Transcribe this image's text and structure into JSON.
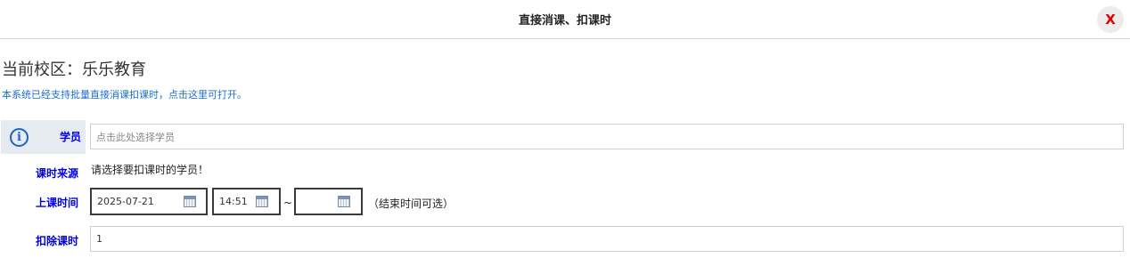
{
  "dialog": {
    "title": "直接消课、扣课时",
    "close_label": "X"
  },
  "campus": {
    "label": "当前校区：乐乐教育"
  },
  "notice": {
    "text": "本系统已经支持批量直接消课扣课时，点击这里可打开。"
  },
  "form": {
    "student": {
      "label": "学员",
      "placeholder": "点击此处选择学员",
      "value": ""
    },
    "source": {
      "label": "课时来源",
      "text": "请选择要扣课时的学员！"
    },
    "time": {
      "label": "上课时间",
      "date": "2025-07-21",
      "start": "14:51",
      "separator": "~",
      "end": "",
      "hint": "（结束时间可选）"
    },
    "deduct": {
      "label": "扣除课时",
      "value": "1"
    }
  },
  "icons": {
    "info": "info-icon",
    "calendar": "calendar-icon"
  }
}
